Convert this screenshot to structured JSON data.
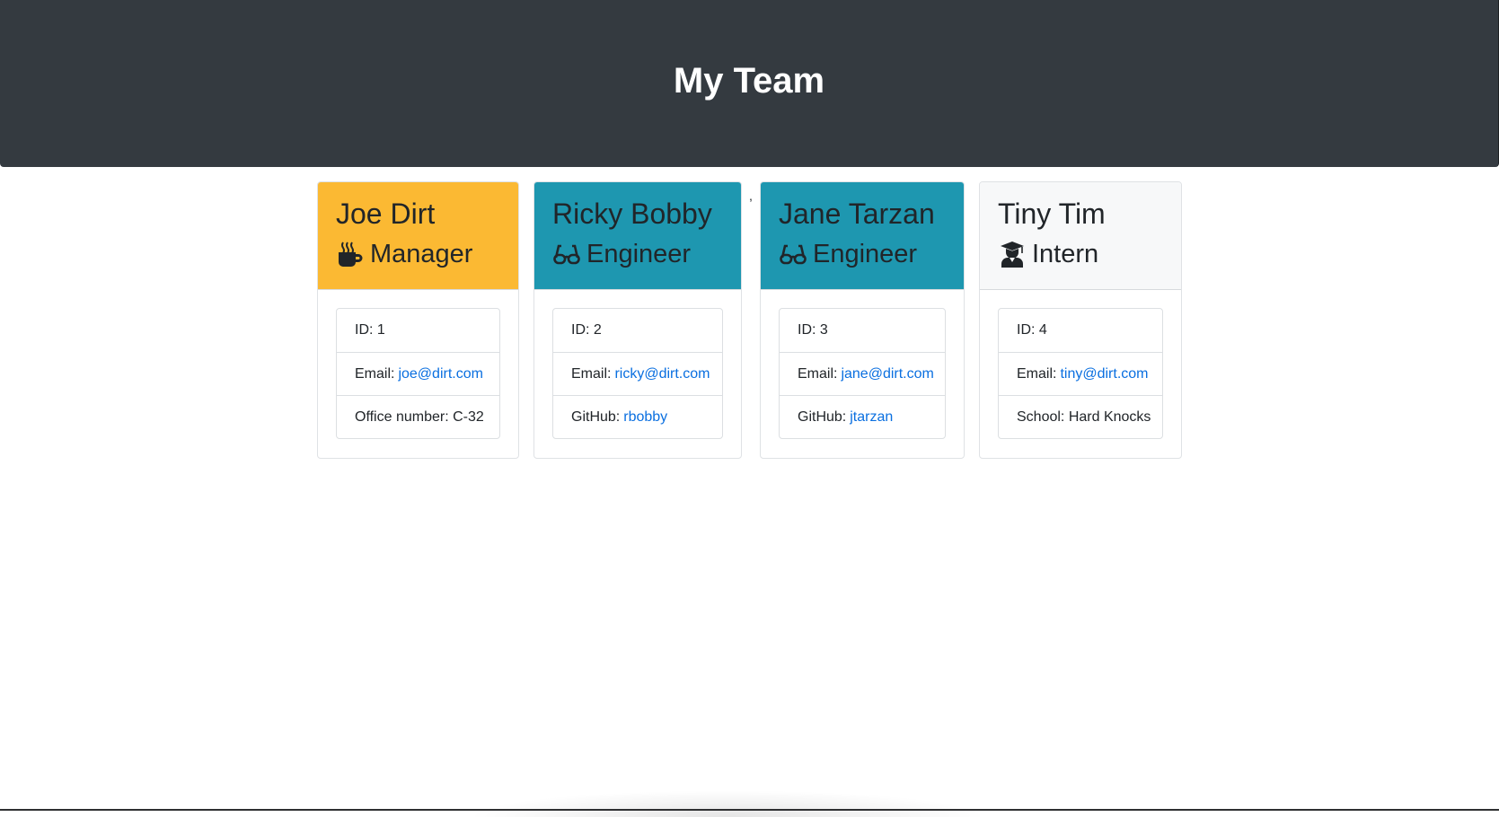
{
  "header": {
    "title": "My Team"
  },
  "stray_text": ",",
  "members": [
    {
      "name": "Joe Dirt",
      "role": "Manager",
      "role_icon": "mug-icon",
      "header_color": "#fbb933",
      "id_label": "ID: 1",
      "email_label": "Email:",
      "email": "joe@dirt.com",
      "extra_label": "Office number: C-32",
      "extra_link": ""
    },
    {
      "name": "Ricky Bobby",
      "role": "Engineer",
      "role_icon": "glasses-icon",
      "header_color": "#1e97b0",
      "id_label": "ID: 2",
      "email_label": "Email:",
      "email": "ricky@dirt.com",
      "extra_label": "GitHub:",
      "extra_link": "rbobby"
    },
    {
      "name": "Jane Tarzan",
      "role": "Engineer",
      "role_icon": "glasses-icon",
      "header_color": "#1e97b0",
      "id_label": "ID: 3",
      "email_label": "Email:",
      "email": "jane@dirt.com",
      "extra_label": "GitHub:",
      "extra_link": "jtarzan"
    },
    {
      "name": "Tiny Tim",
      "role": "Intern",
      "role_icon": "graduate-icon",
      "header_color": "#f7f8f9",
      "id_label": "ID: 4",
      "email_label": "Email:",
      "email": "tiny@dirt.com",
      "extra_label": "School: Hard Knocks",
      "extra_link": ""
    }
  ]
}
